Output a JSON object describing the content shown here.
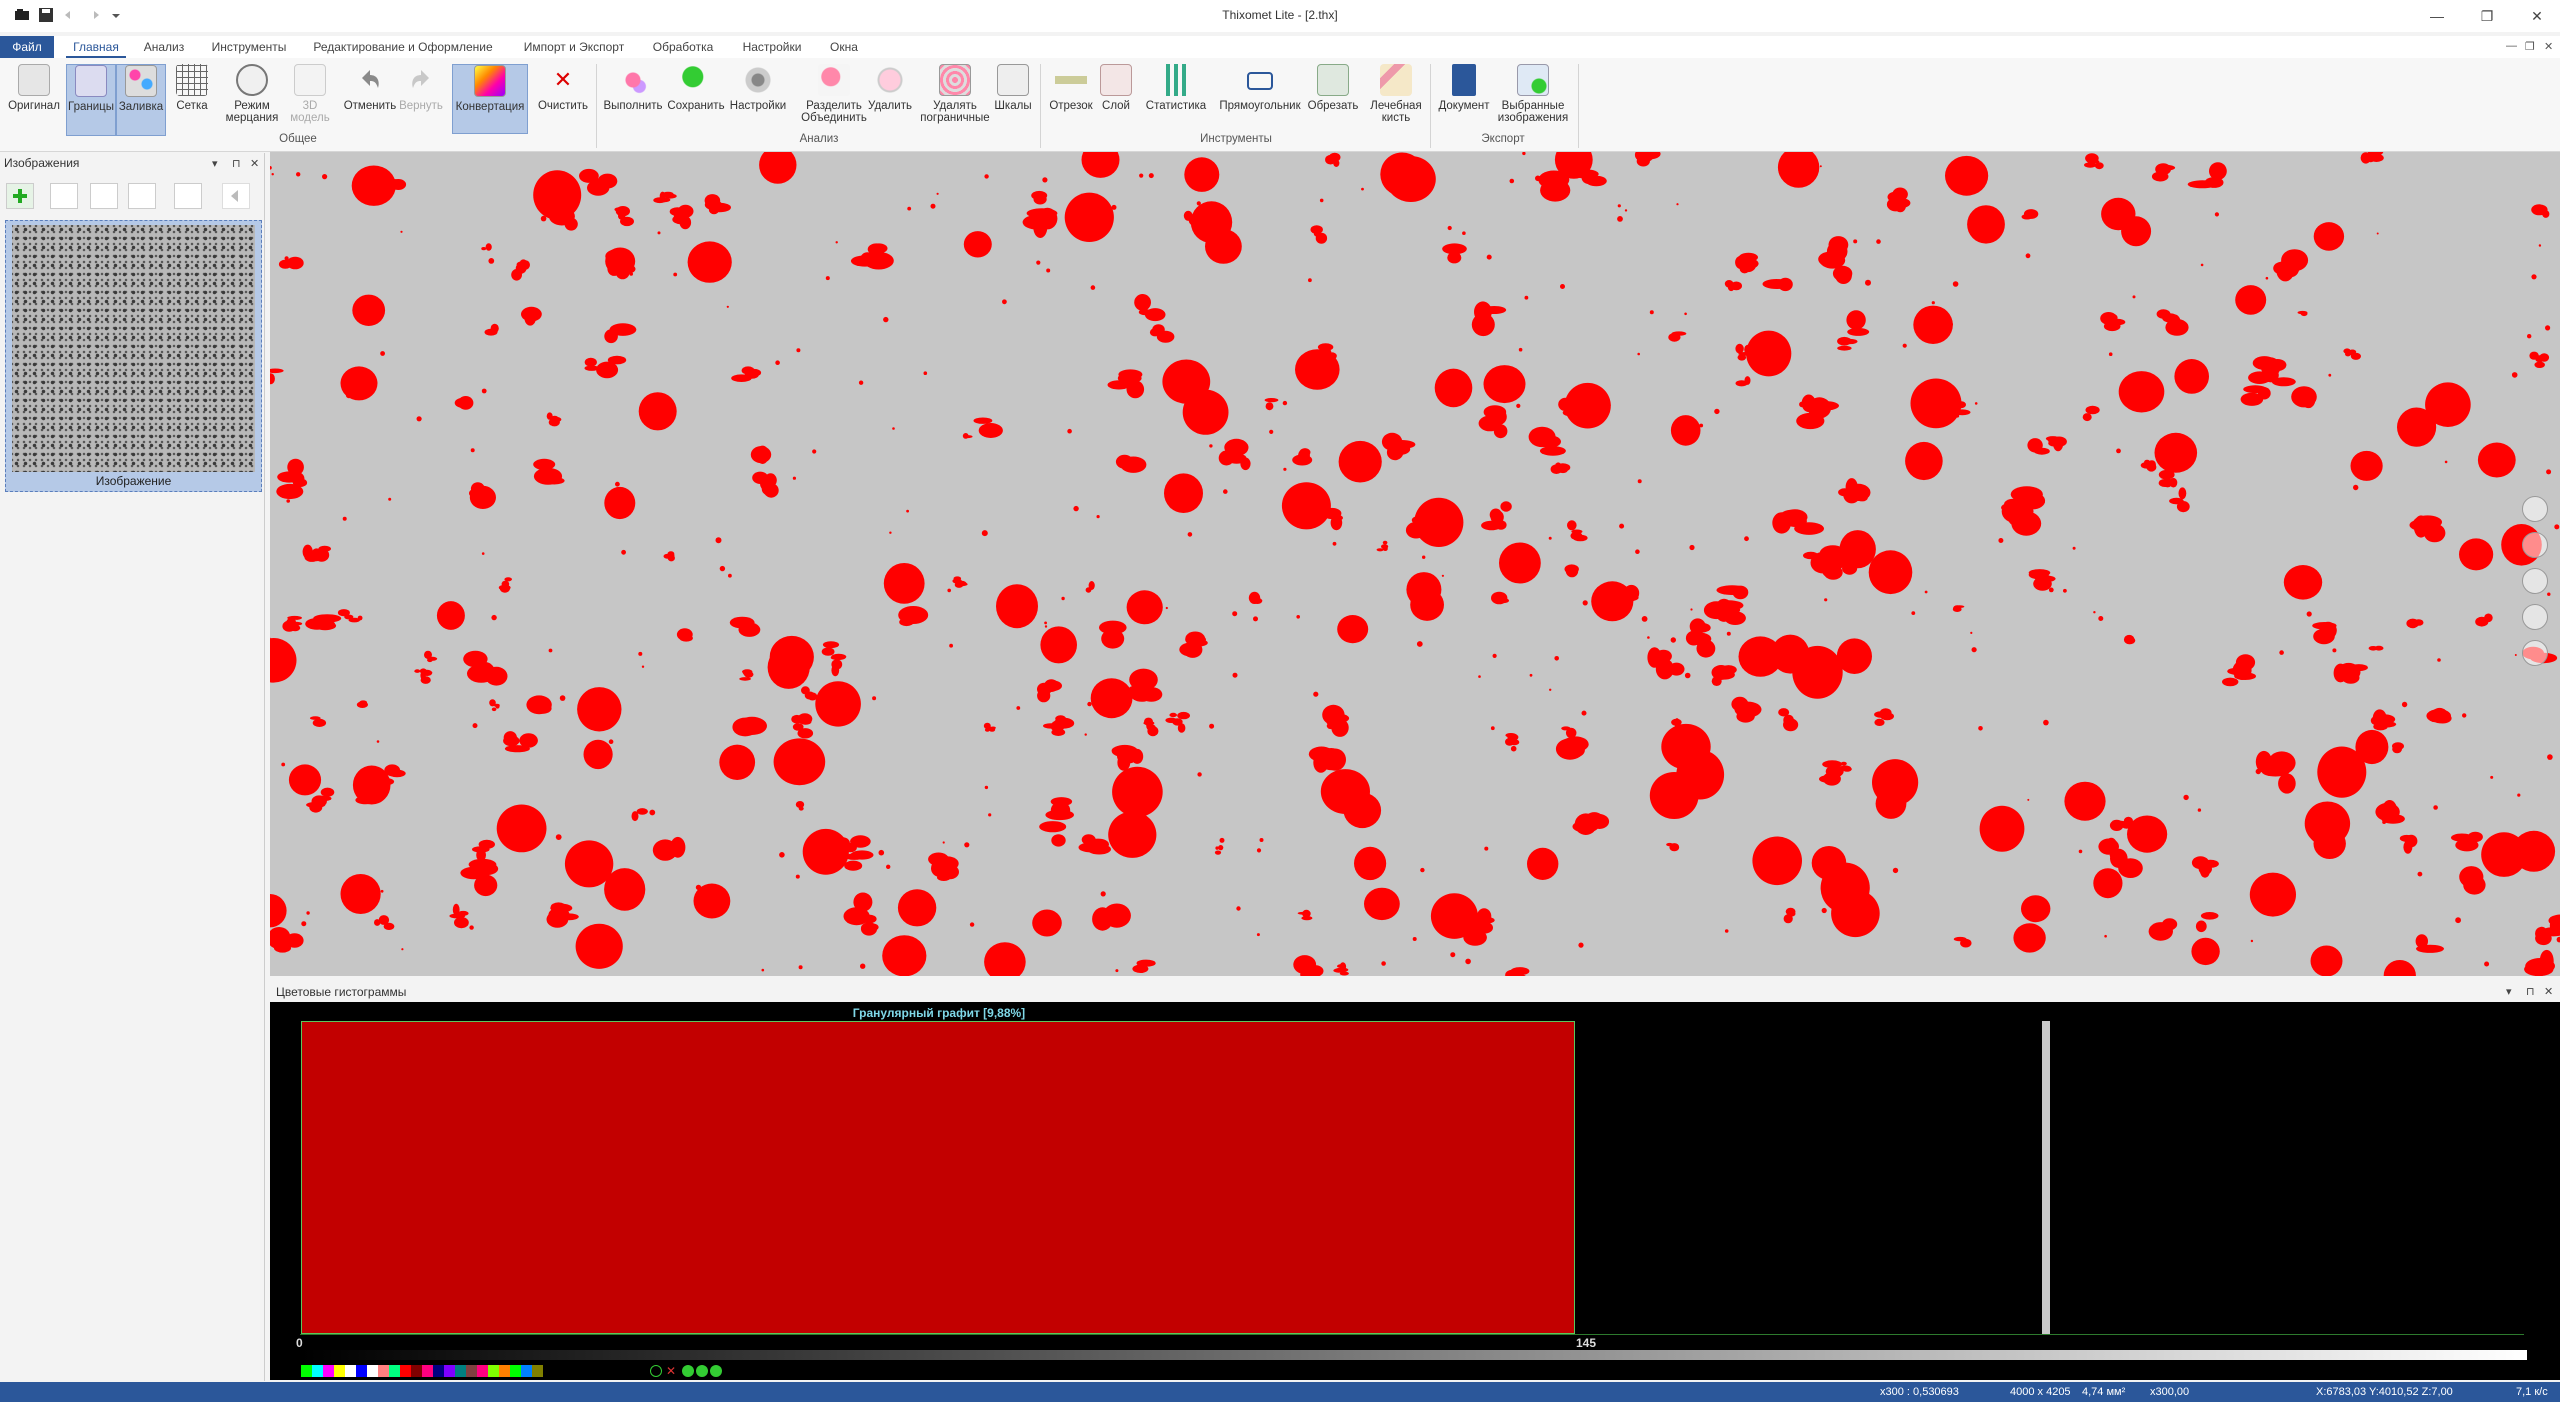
{
  "window": {
    "title": "Thixomet Lite - [2.thx]",
    "controls": [
      "—",
      "❐",
      "✕"
    ]
  },
  "menu": {
    "tabs": [
      {
        "label": "Файл"
      },
      {
        "label": "Главная"
      },
      {
        "label": "Анализ"
      },
      {
        "label": "Инструменты"
      },
      {
        "label": "Редактирование и Оформление"
      },
      {
        "label": "Импорт и Экспорт"
      },
      {
        "label": "Обработка"
      },
      {
        "label": "Настройки"
      },
      {
        "label": "Окна"
      }
    ],
    "active": "Главная"
  },
  "ribbon": {
    "groups": {
      "general": "Общее",
      "analysis": "Анализ",
      "tools": "Инструменты",
      "export": "Экспорт"
    },
    "buttons": {
      "original": "Оригинал",
      "borders": "Границы",
      "fill": "Заливка",
      "grid": "Сетка",
      "flicker_l1": "Режим",
      "flicker_l2": "мерцания",
      "model3d_l1": "3D",
      "model3d_l2": "модель",
      "undo": "Отменить",
      "redo": "Вернуть",
      "convert": "Конвертация",
      "clear": "Очистить",
      "run": "Выполнить",
      "save": "Сохранить",
      "settings": "Настройки",
      "split_l1": "Разделить",
      "split_l2": "Объединить",
      "delete": "Удалить",
      "delborder_l1": "Удалять",
      "delborder_l2": "пограничные",
      "scales": "Шкалы",
      "segment": "Отрезок",
      "layer": "Слой",
      "statistics": "Статистика",
      "rectangle": "Прямоугольник",
      "crop": "Обрезать",
      "brush_l1": "Лечебная",
      "brush_l2": "кисть",
      "document": "Документ",
      "selected_l1": "Выбранные",
      "selected_l2": "изображения"
    }
  },
  "images_panel": {
    "title": "Изображения",
    "thumb_label": "Изображение"
  },
  "histogram": {
    "panel_title": "Цветовые гистограммы",
    "phase_label": "Гранулярный графит [9,88%]",
    "range_start": "0",
    "range_end": "145",
    "phase_fraction_percent": 9.88,
    "phase_color": "#c20000",
    "palette": [
      "#00ff00",
      "#00ffff",
      "#ff00ff",
      "#ffff00",
      "#ffffff",
      "#0000ff",
      "#ffffff",
      "#ff8080",
      "#00ff80",
      "#ff0000",
      "#800000",
      "#ff0080",
      "#000080",
      "#8000ff",
      "#008080",
      "#804040",
      "#ff0080",
      "#80ff00",
      "#ff8000",
      "#00ff00",
      "#0080ff",
      "#808000"
    ]
  },
  "status": {
    "scale": "х300 : 0,530693",
    "size": "4000 x 4205",
    "area": "4,74 мм²",
    "zoom": "х300,00",
    "coords": "X:6783,03 Y:4010,52 Z:7,00",
    "fps": "7,1 к/с"
  },
  "colors": {
    "accent": "#2b579a",
    "particles": "#ff0000",
    "background": "#c6c6c6"
  }
}
